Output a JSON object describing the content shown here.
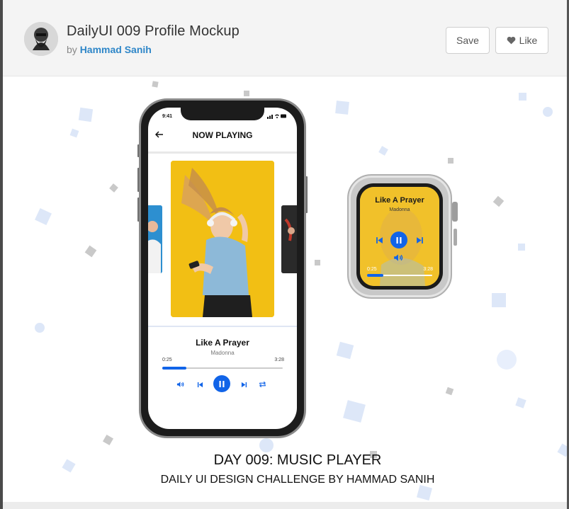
{
  "shot": {
    "title": "DailyUI 009 Profile Mockup",
    "by_prefix": "by",
    "author": "Hammad Sanih"
  },
  "actions": {
    "save_label": "Save",
    "like_label": "Like"
  },
  "phone": {
    "status_time": "9:41",
    "screen_title": "NOW PLAYING",
    "song_title": "Like A Prayer",
    "artist": "Madonna",
    "time_elapsed": "0:25",
    "time_total": "3:28",
    "progress_fraction": 0.2,
    "controls": [
      "volume-icon",
      "previous-icon",
      "pause-icon",
      "next-icon",
      "repeat-icon"
    ]
  },
  "watch": {
    "song_title": "Like A Prayer",
    "artist": "Madonna",
    "time_elapsed": "0:25",
    "time_total": "3:28",
    "progress_fraction": 0.25,
    "controls": [
      "previous-icon",
      "pause-icon",
      "next-icon",
      "volume-icon"
    ]
  },
  "caption": {
    "line1": "DAY 009: MUSIC PLAYER",
    "line2": "DAILY UI DESIGN CHALLENGE BY HAMMAD SANIH"
  },
  "colors": {
    "accent": "#1164e8",
    "album_yellow": "#f2bf14",
    "link": "#2e86c8",
    "confetti": "#d9e6fa"
  }
}
